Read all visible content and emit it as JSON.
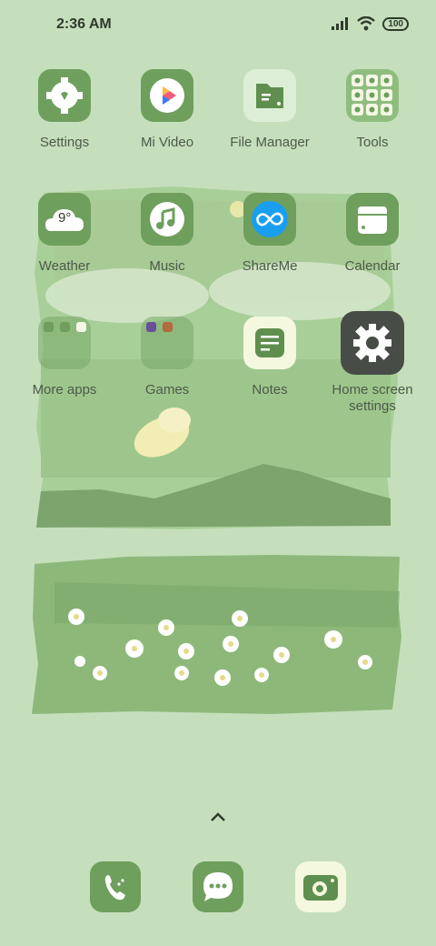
{
  "status_bar": {
    "time": "2:36 AM",
    "battery": "100"
  },
  "apps": {
    "settings": {
      "label": "Settings"
    },
    "mi_video": {
      "label": "Mi Video"
    },
    "file_manager": {
      "label": "File Manager"
    },
    "tools": {
      "label": "Tools"
    },
    "weather": {
      "label": "Weather",
      "temperature": "9°"
    },
    "music": {
      "label": "Music"
    },
    "shareme": {
      "label": "ShareMe"
    },
    "calendar": {
      "label": "Calendar"
    },
    "more_apps": {
      "label": "More apps"
    },
    "games": {
      "label": "Games"
    },
    "notes": {
      "label": "Notes"
    },
    "home_screen_settings": {
      "label": "Home screen settings"
    }
  },
  "colors": {
    "background": "#c5dfbc",
    "icon_green": "#6e9f5d",
    "icon_cream": "#f4f8de",
    "text": "#4d5a48"
  },
  "dock": [
    "phone-icon",
    "messages-icon",
    "camera-icon"
  ]
}
